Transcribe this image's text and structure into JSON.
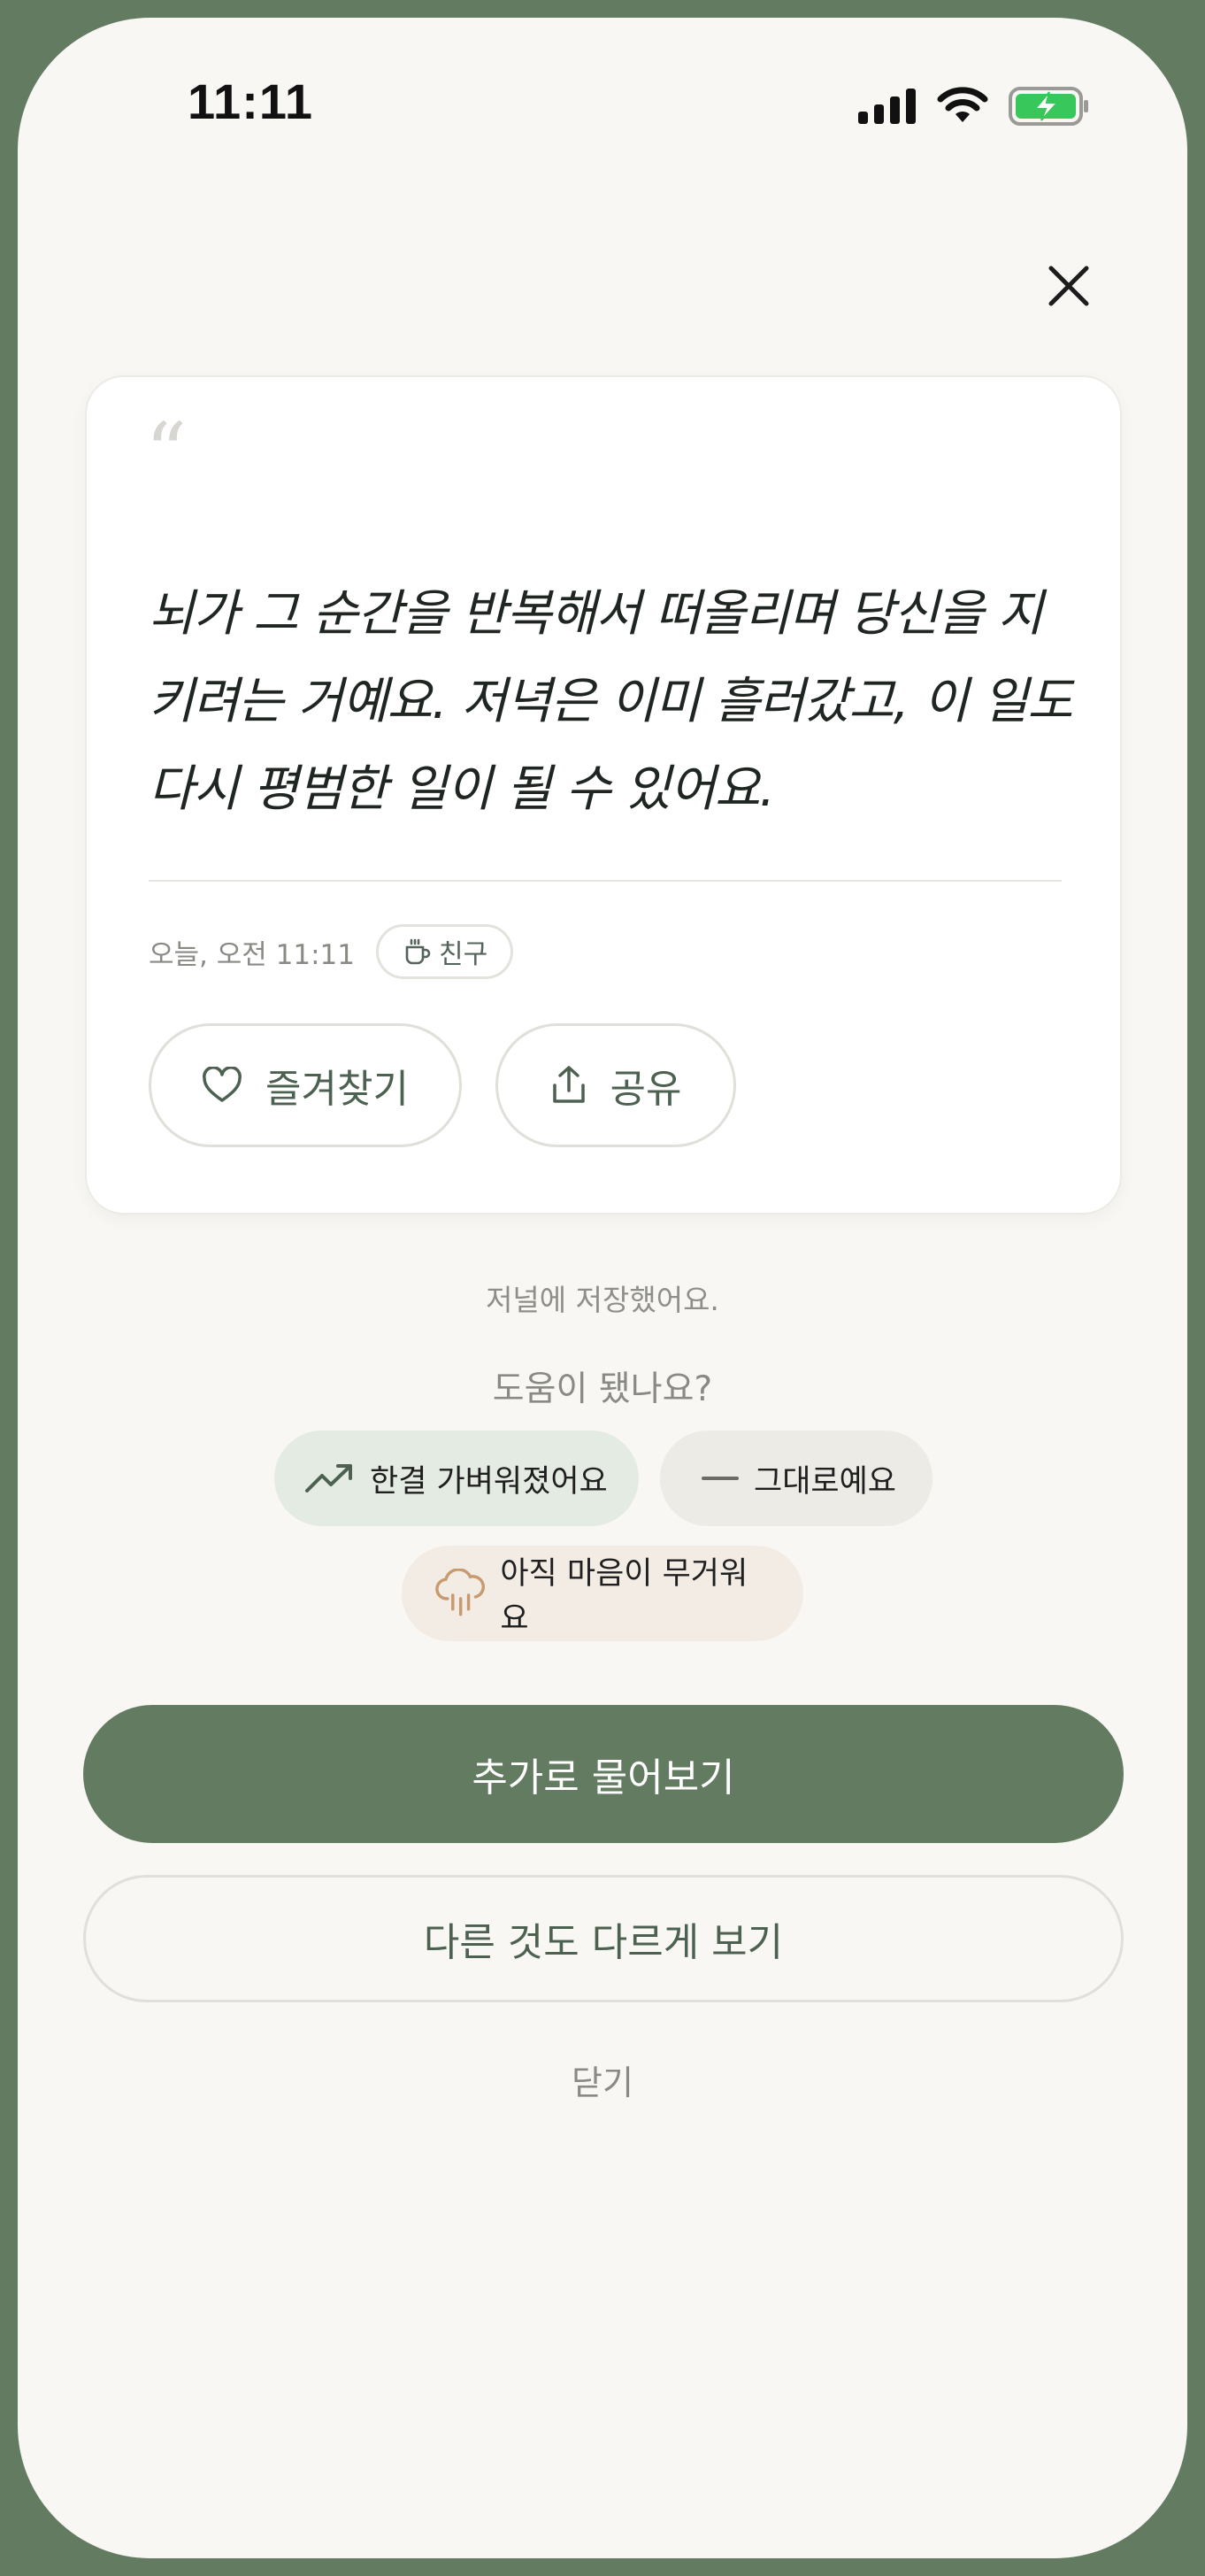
{
  "status_bar": {
    "time": "11:11",
    "icons": [
      "cellular-signal-icon",
      "wifi-icon",
      "battery-charging-icon"
    ]
  },
  "close_icon": "close-icon",
  "card": {
    "quote_mark": "“",
    "quote": "뇌가 그 순간을 반복해서 떠올리며 당신을 지키려는 거예요. 저녁은 이미 흘러갔고, 이 일도 다시 평범한 일이 될 수 있어요.",
    "timestamp": "오늘, 오전 11:11",
    "tag": {
      "icon": "coffee-cup-icon",
      "label": "친구"
    },
    "favorite_label": "즐겨찾기",
    "share_label": "공유"
  },
  "saved_note": "저널에 저장했어요.",
  "help_question": "도움이 됐나요?",
  "feedback": [
    {
      "icon": "trending-up-icon",
      "label": "한결 가벼워졌어요"
    },
    {
      "icon": "minus-icon",
      "label": "그대로예요"
    },
    {
      "icon": "rain-cloud-icon",
      "label": "아직 마음이 무거워요"
    }
  ],
  "primary_action": "추가로 물어보기",
  "secondary_action": "다른 것도 다르게 보기",
  "close_label": "닫기",
  "colors": {
    "brand_green": "#637c61",
    "background": "#f8f7f3",
    "chip_light": "#e4ebe2",
    "chip_neutral": "#ecebe6",
    "chip_heavy": "#f3ece5",
    "battery_green": "#37c75a",
    "rain_icon": "#c79a70"
  }
}
